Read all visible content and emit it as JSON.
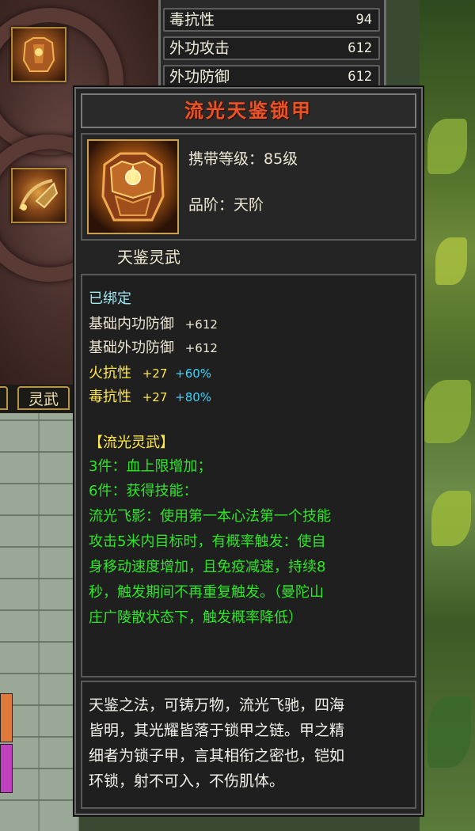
{
  "stats": [
    {
      "label": "毒抗性",
      "value": "94"
    },
    {
      "label": "外功攻击",
      "value": "612"
    },
    {
      "label": "外功防御",
      "value": "612"
    }
  ],
  "tabs": [
    {
      "label": "灵武"
    }
  ],
  "tooltip": {
    "title": "流光天鉴锁甲",
    "level_line": "携带等级：85级",
    "grade_line": "品阶：天阶",
    "subheader": "天鉴灵武",
    "bound": "已绑定",
    "attributes": [
      {
        "label": "基础内功防御",
        "value": "+612"
      },
      {
        "label": "基础外功防御",
        "value": "+612"
      }
    ],
    "resists": [
      {
        "label": "火抗性",
        "value": "+27",
        "bonus": "+60%"
      },
      {
        "label": "毒抗性",
        "value": "+27",
        "bonus": "+80%"
      }
    ],
    "set_name": "【流光灵武】",
    "set_lines": [
      "3件：血上限增加；",
      "6件：获得技能：",
      "流光飞影：使用第一本心法第一个技能",
      "攻击5米内目标时，有概率触发：使自",
      "身移动速度增加，且免疫减速，持续8",
      "秒，触发期间不再重复触发。（曼陀山",
      "庄广陵散状态下，触发概率降低）"
    ],
    "lore_lines": [
      "天鉴之法，可铸万物，流光飞驰，四海",
      "皆明，其光耀皆落于锁甲之链。甲之精",
      "细者为锁子甲，言其相衔之密也，铠如",
      "环锁，射不可入，不伤肌体。"
    ]
  },
  "colors": {
    "title": "#e6542a",
    "bound": "#9ee6f0",
    "resist": "#ffe84a",
    "bonus": "#3ad4ff",
    "set": "#2ee628"
  },
  "icons": {
    "item": "armor-chest-icon",
    "slot_1": "armor-slot-icon",
    "slot_2": "chain-weapon-slot-icon"
  }
}
